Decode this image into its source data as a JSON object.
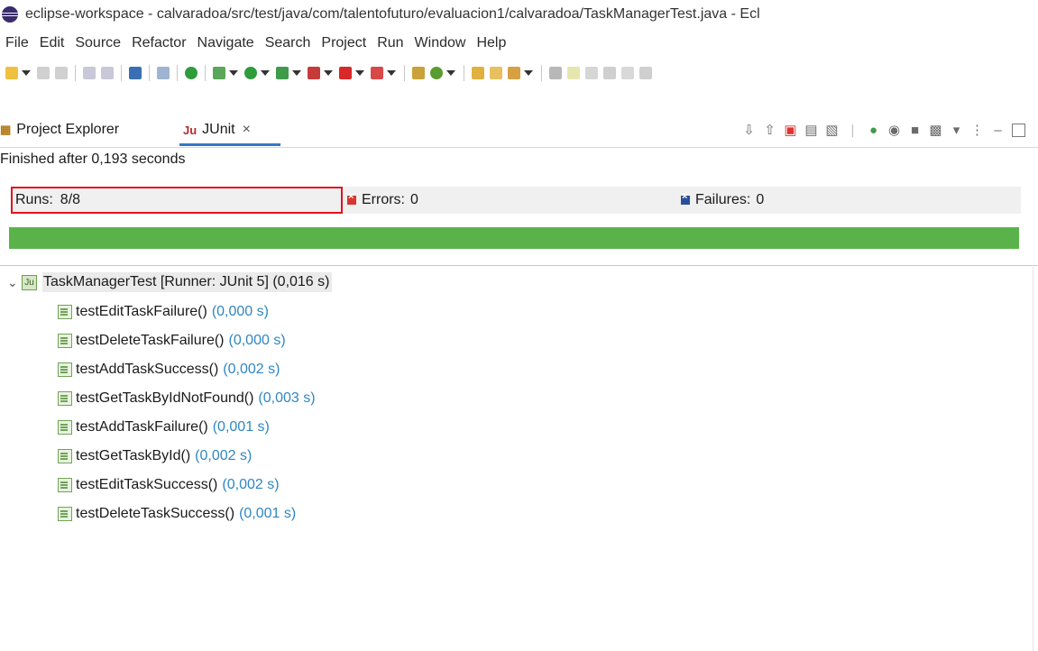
{
  "window": {
    "title": "eclipse-workspace - calvaradoa/src/test/java/com/talentofuturo/evaluacion1/calvaradoa/TaskManagerTest.java - Ecl"
  },
  "menu": [
    "File",
    "Edit",
    "Source",
    "Refactor",
    "Navigate",
    "Search",
    "Project",
    "Run",
    "Window",
    "Help"
  ],
  "tabs": {
    "project_explorer": "Project Explorer",
    "junit": "JUnit",
    "junit_icon_text": "Ju"
  },
  "junit": {
    "status": "Finished after 0,193 seconds",
    "runs_label": "Runs:",
    "runs_value": "8/8",
    "errors_label": "Errors:",
    "errors_value": "0",
    "failures_label": "Failures:",
    "failures_value": "0",
    "bar_color": "#5ab34a"
  },
  "tree": {
    "root": "TaskManagerTest [Runner: JUnit 5] (0,016 s)",
    "tests": [
      {
        "name": "testEditTaskFailure()",
        "time": "(0,000 s)"
      },
      {
        "name": "testDeleteTaskFailure()",
        "time": "(0,000 s)"
      },
      {
        "name": "testAddTaskSuccess()",
        "time": "(0,002 s)"
      },
      {
        "name": "testGetTaskByIdNotFound()",
        "time": "(0,003 s)"
      },
      {
        "name": "testAddTaskFailure()",
        "time": "(0,001 s)"
      },
      {
        "name": "testGetTaskById()",
        "time": "(0,002 s)"
      },
      {
        "name": "testEditTaskSuccess()",
        "time": "(0,002 s)"
      },
      {
        "name": "testDeleteTaskSuccess()",
        "time": "(0,001 s)"
      }
    ]
  }
}
